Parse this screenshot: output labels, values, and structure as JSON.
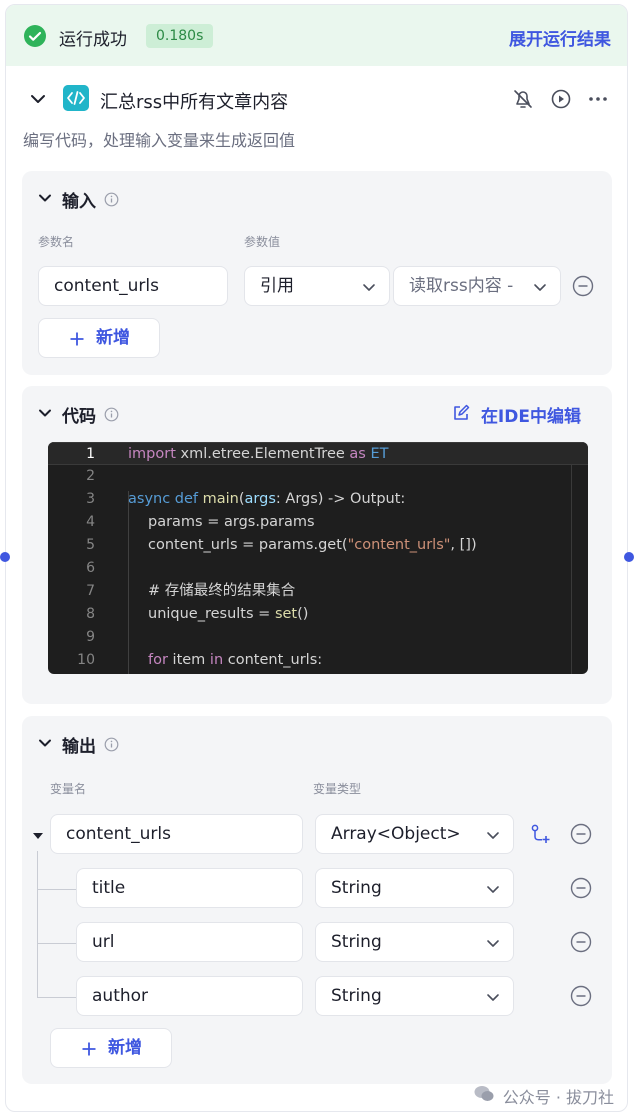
{
  "banner": {
    "status": "运行成功",
    "duration": "0.180s",
    "expand_label": "展开运行结果"
  },
  "node": {
    "title": "汇总rss中所有文章内容",
    "description": "编写代码，处理输入变量来生成返回值"
  },
  "input": {
    "title": "输入",
    "col_name": "参数名",
    "col_value": "参数值",
    "param_name": "content_urls",
    "value_type": "引用",
    "value_ref": "读取rss内容 -",
    "add_label": "新增"
  },
  "code": {
    "title": "代码",
    "ide_label": "在IDE中编辑",
    "lines": [
      "1",
      "2",
      "3",
      "4",
      "5",
      "6",
      "7",
      "8",
      "9",
      "10"
    ]
  },
  "output": {
    "title": "输出",
    "col_name": "变量名",
    "col_type": "变量类型",
    "root": {
      "name": "content_urls",
      "type": "Array<Object>"
    },
    "children": [
      {
        "name": "title",
        "type": "String"
      },
      {
        "name": "url",
        "type": "String"
      },
      {
        "name": "author",
        "type": "String"
      }
    ],
    "add_label": "新增"
  },
  "watermark": "公众号 · 拔刀社",
  "colors": {
    "accent": "#3f57e0",
    "success": "#2fb35a",
    "success_bg": "#eaf7ee",
    "code_bg": "#1e1e1e"
  }
}
